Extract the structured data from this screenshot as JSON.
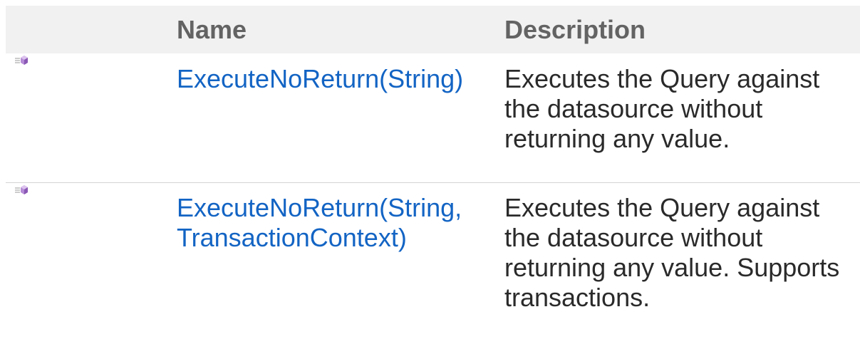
{
  "table": {
    "headers": {
      "icon": "",
      "name": "Name",
      "description": "Description"
    },
    "rows": [
      {
        "icon": "public-method-icon",
        "name": "ExecuteNoReturn(String)",
        "description": "Executes the Query against the datasource without returning any value."
      },
      {
        "icon": "public-method-icon",
        "name": "ExecuteNoReturn(String, TransactionContext)",
        "description": "Executes the Query against the datasource without returning any value. Supports transactions."
      }
    ]
  },
  "colors": {
    "header_background": "#f1f1f1",
    "header_text": "#636363",
    "link": "#1364c4",
    "text": "#2a2a2a",
    "divider": "#d4d4d4",
    "icon_accent": "#b58ad6"
  }
}
